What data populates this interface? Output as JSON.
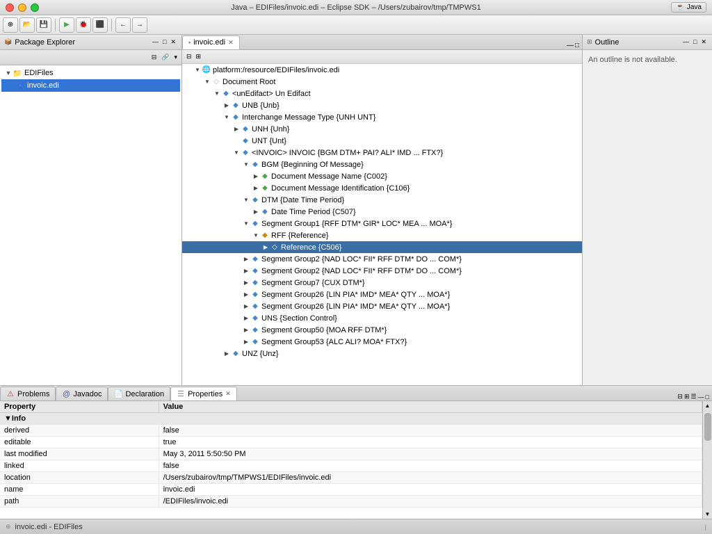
{
  "window": {
    "title": "Java – EDIFiles/invoic.edi – Eclipse SDK – /Users/zubairov/tmp/TMPWS1",
    "java_badge": "Java"
  },
  "package_explorer": {
    "title": "Package Explorer",
    "root": "EDIFiles",
    "file": "invoic.edi"
  },
  "editor": {
    "tab_title": "invoic.edi",
    "tree": {
      "root": "platform:/resource/EDIFiles/invoic.edi",
      "nodes": [
        {
          "label": "Document Root",
          "indent": 1,
          "expanded": true,
          "type": "folder"
        },
        {
          "label": "<unEdifact> Un Edifact",
          "indent": 2,
          "expanded": true,
          "type": "diamond-blue"
        },
        {
          "label": "UNB {Unb}",
          "indent": 3,
          "expanded": false,
          "type": "diamond-blue"
        },
        {
          "label": "Interchange Message Type {UNH  UNT}",
          "indent": 3,
          "expanded": true,
          "type": "diamond-blue"
        },
        {
          "label": "UNH {Unh}",
          "indent": 4,
          "expanded": false,
          "type": "diamond-blue"
        },
        {
          "label": "UNT {Unt}",
          "indent": 4,
          "expanded": false,
          "type": "diamond-blue"
        },
        {
          "label": "<INVOIC> INVOIC {BGM DTM+ PAI? ALI* IMD ... FTX?}",
          "indent": 4,
          "expanded": true,
          "type": "diamond-blue"
        },
        {
          "label": "BGM {Beginning Of Message}",
          "indent": 5,
          "expanded": true,
          "type": "diamond-blue"
        },
        {
          "label": "Document Message Name {C002}",
          "indent": 6,
          "expanded": false,
          "type": "diamond-green"
        },
        {
          "label": "Document Message Identification {C106}",
          "indent": 6,
          "expanded": false,
          "type": "diamond-green"
        },
        {
          "label": "DTM {Date Time Period}",
          "indent": 5,
          "expanded": true,
          "type": "diamond-blue"
        },
        {
          "label": "Date Time Period {C507}",
          "indent": 6,
          "expanded": false,
          "type": "diamond-blue"
        },
        {
          "label": "Segment Group1 {RFF DTM* GIR* LOC* MEA ... MOA*}",
          "indent": 5,
          "expanded": true,
          "type": "diamond-blue"
        },
        {
          "label": "RFF {Reference}",
          "indent": 6,
          "expanded": true,
          "type": "diamond-orange"
        },
        {
          "label": "Reference {C506}",
          "indent": 7,
          "expanded": false,
          "type": "diamond-blue",
          "highlighted": true
        },
        {
          "label": "Segment Group2 {NAD LOC* FII* RFF DTM* DO ... COM*}",
          "indent": 5,
          "expanded": false,
          "type": "diamond-blue"
        },
        {
          "label": "Segment Group2 {NAD LOC* FII* RFF DTM* DO ... COM*}",
          "indent": 5,
          "expanded": false,
          "type": "diamond-blue"
        },
        {
          "label": "Segment Group7 {CUX DTM*}",
          "indent": 5,
          "expanded": false,
          "type": "diamond-blue"
        },
        {
          "label": "Segment Group26 {LIN PIA* IMD* MEA* QTY ... MOA*}",
          "indent": 5,
          "expanded": false,
          "type": "diamond-blue"
        },
        {
          "label": "Segment Group26 {LIN PIA* IMD* MEA* QTY ... MOA*}",
          "indent": 5,
          "expanded": false,
          "type": "diamond-blue"
        },
        {
          "label": "UNS {Section Control}",
          "indent": 5,
          "expanded": false,
          "type": "diamond-blue"
        },
        {
          "label": "Segment Group50 {MOA RFF DTM*}",
          "indent": 5,
          "expanded": false,
          "type": "diamond-blue"
        },
        {
          "label": "Segment Group53 {ALC ALI? MOA* FTX?}",
          "indent": 5,
          "expanded": false,
          "type": "diamond-blue"
        },
        {
          "label": "UNZ {Unz}",
          "indent": 3,
          "expanded": false,
          "type": "diamond-blue"
        }
      ]
    }
  },
  "outline": {
    "title": "Outline",
    "message": "An outline is not available."
  },
  "bottom_tabs": {
    "problems": "Problems",
    "javadoc": "Javadoc",
    "declaration": "Declaration",
    "properties": "Properties",
    "active": "Properties"
  },
  "properties": {
    "header_property": "Property",
    "header_value": "Value",
    "group": "Info",
    "rows": [
      {
        "property": "derived",
        "value": "false"
      },
      {
        "property": "editable",
        "value": "true"
      },
      {
        "property": "last modified",
        "value": "May 3, 2011 5:50:50 PM"
      },
      {
        "property": "linked",
        "value": "false"
      },
      {
        "property": "location",
        "value": "/Users/zubairov/tmp/TMPWS1/EDIFiles/invoic.edi"
      },
      {
        "property": "name",
        "value": "invoic.edi"
      },
      {
        "property": "path",
        "value": "/EDIFiles/invoic.edi"
      }
    ]
  },
  "statusbar": {
    "left": "invoic.edi - EDIFiles",
    "right": ""
  }
}
